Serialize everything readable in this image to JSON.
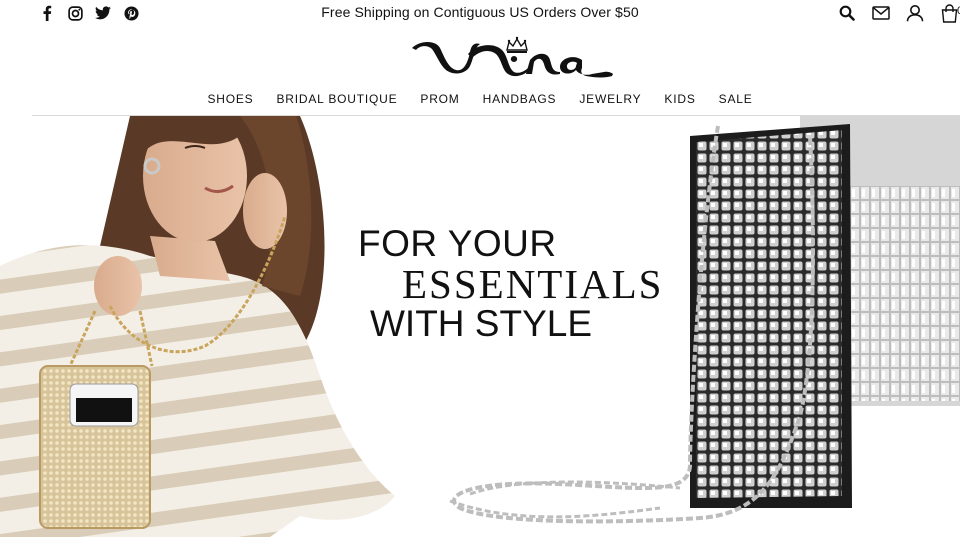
{
  "topbar": {
    "promo": "Free Shipping on Contiguous US Orders Over $50",
    "social_icons": [
      "facebook-icon",
      "instagram-icon",
      "twitter-icon",
      "pinterest-icon"
    ],
    "utility_icons": [
      "search-icon",
      "mail-icon",
      "account-icon",
      "cart-icon"
    ],
    "cart_count": "0"
  },
  "logo": {
    "text": "Nina"
  },
  "nav": {
    "items": [
      {
        "label": "SHOES"
      },
      {
        "label": "BRIDAL BOUTIQUE"
      },
      {
        "label": "PROM"
      },
      {
        "label": "HANDBAGS"
      },
      {
        "label": "JEWELRY"
      },
      {
        "label": "KIDS"
      },
      {
        "label": "SALE"
      }
    ]
  },
  "hero": {
    "line1": "FOR YOUR",
    "line2": "ESSENTIALS",
    "line3": "WITH STYLE"
  },
  "colors": {
    "text": "#111111",
    "background": "#ffffff",
    "rule": "#d8d8d8"
  }
}
